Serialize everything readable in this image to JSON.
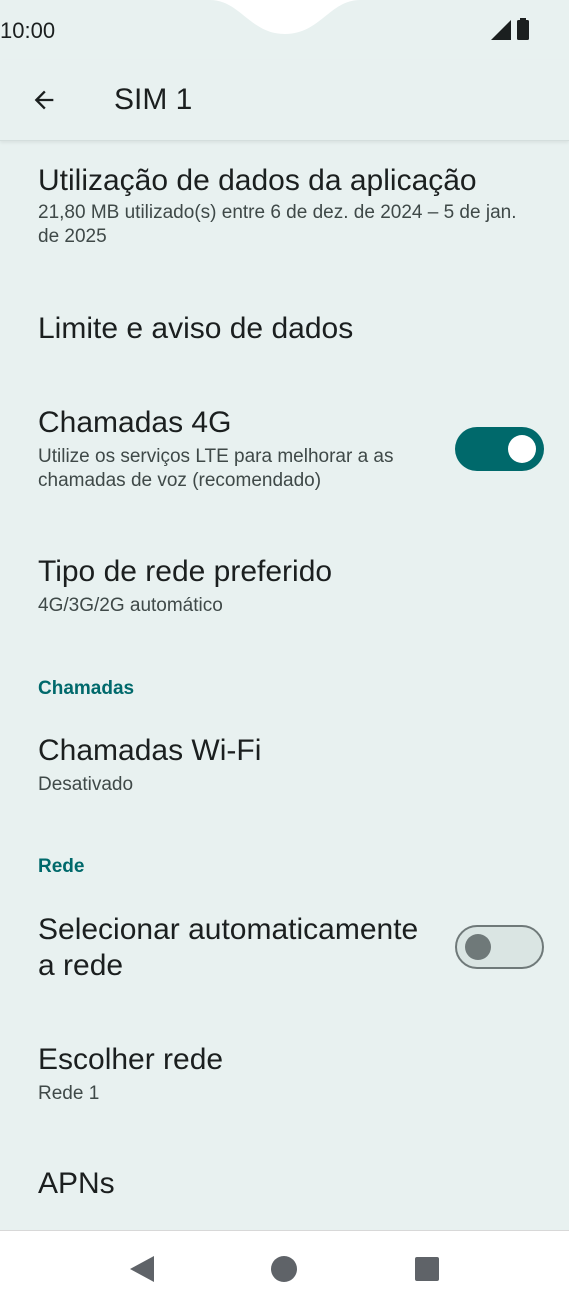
{
  "status_bar": {
    "time": "10:00"
  },
  "app_bar": {
    "title": "SIM 1"
  },
  "preferences": {
    "app_data_usage": {
      "title": "Utilização de dados da aplicação",
      "summary": "21,80 MB utilizado(s) entre 6 de dez. de 2024 – 5 de jan. de 2025"
    },
    "data_limit": {
      "title": "Limite e aviso de dados"
    },
    "calls_4g": {
      "title": "Chamadas 4G",
      "summary": "Utilize os serviços LTE para melhorar a as chamadas de voz (recomendado)",
      "enabled": true
    },
    "network_type": {
      "title": "Tipo de rede preferido",
      "summary": "4G/3G/2G automático"
    },
    "category_calls": "Chamadas",
    "wifi_calls": {
      "title": "Chamadas Wi-Fi",
      "summary": "Desativado"
    },
    "category_network": "Rede",
    "auto_select": {
      "title": "Selecionar automaticamente a rede",
      "enabled": false
    },
    "choose_network": {
      "title": "Escolher rede",
      "summary": "Rede 1"
    },
    "apns": {
      "title": "APNs"
    }
  },
  "colors": {
    "background": "#e8f1f0",
    "accent": "#00696b",
    "text_primary": "#1b1f1f",
    "text_secondary": "#3f4948"
  },
  "icons": {
    "back": "arrow-back-icon",
    "signal": "signal-icon",
    "battery": "battery-icon",
    "nav_back": "nav-back-icon",
    "nav_home": "nav-home-icon",
    "nav_recents": "nav-recents-icon"
  }
}
